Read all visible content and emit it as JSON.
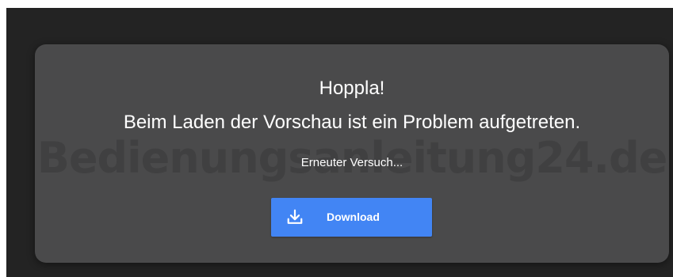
{
  "dialog": {
    "title": "Hoppla!",
    "message": "Beim Laden der Vorschau ist ein Problem aufgetreten.",
    "retry_label": "Erneuter Versuch...",
    "download_label": "Download",
    "download_icon": "download-icon"
  },
  "watermark": {
    "text": "Bedienungsanleitung24.de"
  },
  "colors": {
    "page_background": "#ffffff",
    "viewer_background": "#232323",
    "dialog_background": "#4a4a4b",
    "accent": "#4285f4",
    "text": "#ffffff"
  }
}
